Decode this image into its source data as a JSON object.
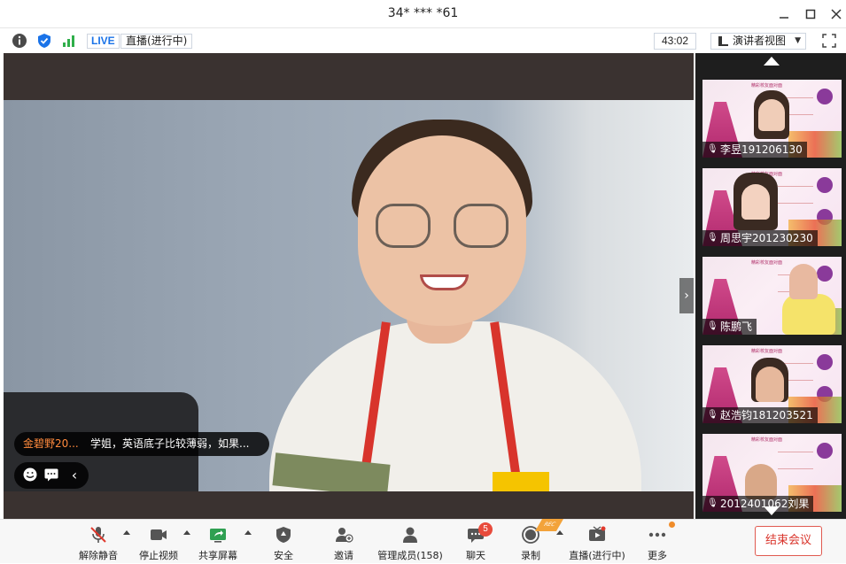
{
  "window": {
    "title": "34* *** *61"
  },
  "infobar": {
    "live_badge": "LIVE",
    "live_status": "直播(进行中)",
    "timer": "43:02",
    "view_mode": "演讲者视图"
  },
  "chat_overlay": {
    "sender": "金碧野20...",
    "message": "学姐，英语底子比较薄弱，如果..."
  },
  "participants": [
    {
      "name": "李昱191206130",
      "muted": true
    },
    {
      "name": "周思宇201230230",
      "muted": true
    },
    {
      "name": "陈鹏飞",
      "muted": true
    },
    {
      "name": "赵浩钧181203521",
      "muted": true
    },
    {
      "name": "2012401062刘果",
      "muted": true
    }
  ],
  "slide_title": "精彩校友面对面",
  "toolbar": {
    "unmute": "解除静音",
    "stop_video": "停止视频",
    "share_screen": "共享屏幕",
    "security": "安全",
    "invite": "邀请",
    "manage_members": "管理成员(158)",
    "chat": "聊天",
    "chat_badge": "5",
    "record": "录制",
    "record_ribbon": "REC",
    "live": "直播(进行中)",
    "more": "更多",
    "end_meeting": "结束会议"
  },
  "colors": {
    "accent_blue": "#1a73e8",
    "end_red": "#d9342b",
    "chat_sender": "#ff8a3d",
    "badge_red": "#e84b3c"
  }
}
